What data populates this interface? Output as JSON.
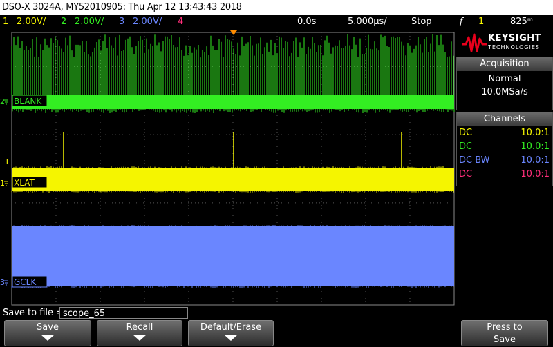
{
  "title": "DSO-X 3024A, MY52010905: Thu Apr 12 13:43:43 2018",
  "status": {
    "ch1_num": "1",
    "ch1_scale": "2.00V/",
    "ch2_num": "2",
    "ch2_scale": "2.00V/",
    "ch3_num": "3",
    "ch3_scale": "2.00V/",
    "ch4_num": "4",
    "time_delay": "0.0s",
    "time_scale": "5.000μs/",
    "run_state": "Stop",
    "trigger_icon": "ƒ",
    "trigger_source": "1",
    "trigger_level": "825ᵐ"
  },
  "logo": {
    "brand": "KEYSIGHT",
    "sub": "TECHNOLOGIES"
  },
  "acquisition": {
    "header": "Acquisition",
    "mode": "Normal",
    "rate": "10.0MSa/s"
  },
  "channels_panel": {
    "header": "Channels",
    "rows": [
      {
        "coupling": "DC",
        "probe": "10.0:1",
        "color": "#f5f500"
      },
      {
        "coupling": "DC",
        "probe": "10.0:1",
        "color": "#33ee22"
      },
      {
        "coupling": "DC BW",
        "probe": "10.0:1",
        "color": "#6a86ff"
      },
      {
        "coupling": "DC",
        "probe": "10.0:1",
        "color": "#ff2e7a"
      }
    ]
  },
  "waveforms": {
    "ch2_num": "2",
    "ch2_label": "BLANK",
    "ch1_num": "1",
    "ch1_label": "XLAT",
    "ch3_num": "3",
    "ch3_label": "GCLK",
    "trigger_marker": "T"
  },
  "save": {
    "label": "Save to file =",
    "filename": "scope_65"
  },
  "softkeys": {
    "save": "Save",
    "recall": "Recall",
    "default_erase": "Default/Erase",
    "press_to_line1": "Press to",
    "press_to_line2": "Save"
  },
  "colors": {
    "ch1": "#f5f500",
    "ch2": "#33ee22",
    "ch3": "#6a86ff",
    "ch4": "#ff2e7a",
    "trigger_marker": "#ff8c00"
  }
}
